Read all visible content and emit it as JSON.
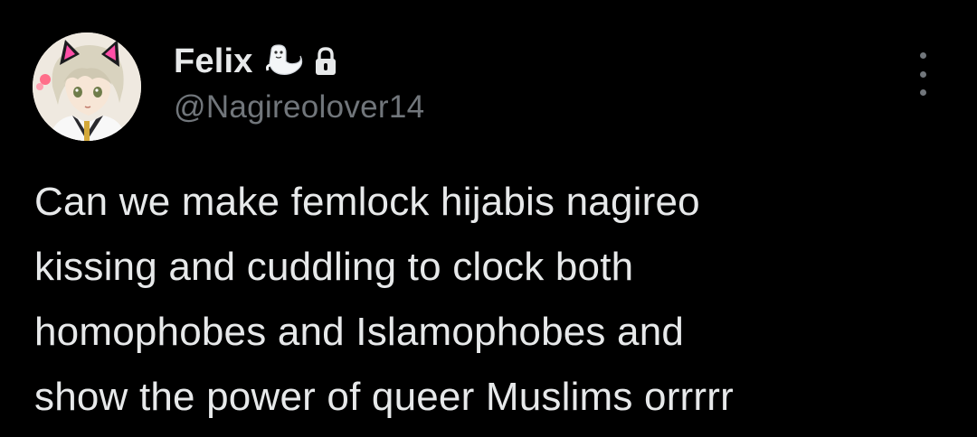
{
  "colors": {
    "background": "#000000",
    "primary_text": "#e7e9ea",
    "secondary_text": "#71767b"
  },
  "author": {
    "display_name": "Felix",
    "handle": "@Nagireolover14",
    "name_emoji_icon": "ghost-seal-icon",
    "protected_icon": "lock-icon",
    "avatar": "avatar-cat-ear-anime-character"
  },
  "menu": {
    "icon": "more-vertical-icon"
  },
  "tweet": {
    "lines": [
      "Can we make femlock hijabis nagireo",
      "kissing and cuddling to clock both",
      "homophobes and Islamophobes and",
      "show the power of queer Muslims orrrrr"
    ]
  }
}
